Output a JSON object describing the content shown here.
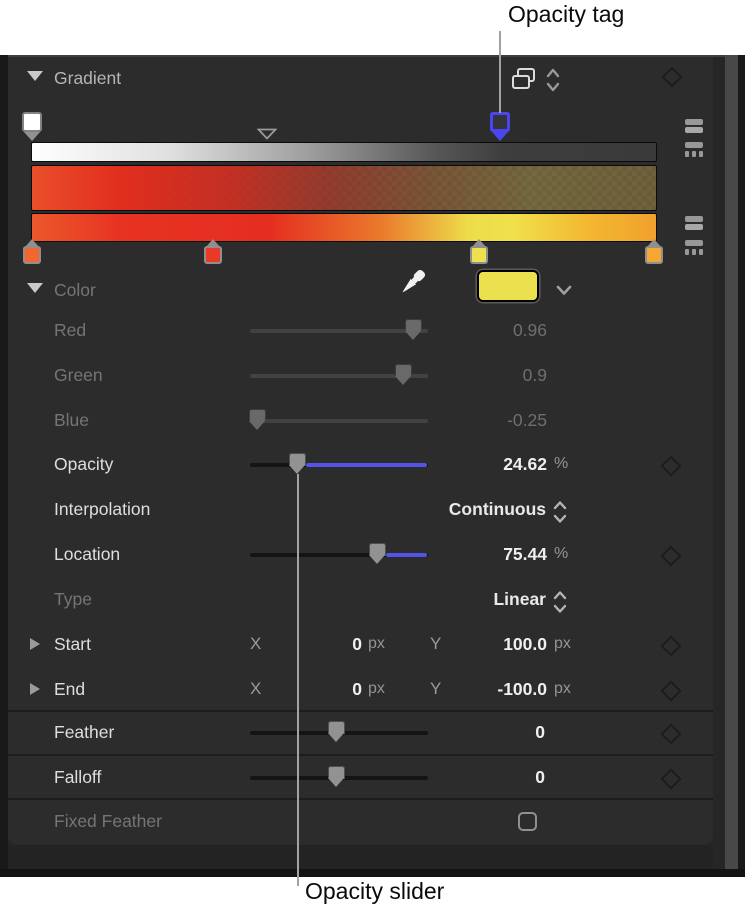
{
  "callouts": {
    "top_label": "Opacity tag",
    "bottom_label": "Opacity slider"
  },
  "gradient_section": {
    "title": "Gradient",
    "opacity_bar": {
      "left_stop_color": "#ffffff",
      "right_stop_color": "#3a3a3a",
      "selected_tag_location_pct": 75,
      "midpoint_pct": 38
    },
    "color_bar_stops": [
      "#ec582c",
      "#e63322",
      "#eedd4a",
      "#f1a02e"
    ],
    "color_tags": [
      {
        "color": "#f2672f",
        "position_pct": 0
      },
      {
        "color": "#e93a28",
        "position_pct": 29
      },
      {
        "color": "#eee04e",
        "position_pct": 72
      },
      {
        "color": "#f6a733",
        "position_pct": 100
      }
    ]
  },
  "color_section": {
    "title": "Color",
    "swatch_color": "#ebe14f",
    "red": {
      "label": "Red",
      "value": "0.96"
    },
    "green": {
      "label": "Green",
      "value": "0.9"
    },
    "blue": {
      "label": "Blue",
      "value": "-0.25"
    }
  },
  "params": {
    "opacity": {
      "label": "Opacity",
      "value": "24.62",
      "unit": "%"
    },
    "interpolation": {
      "label": "Interpolation",
      "value": "Continuous"
    },
    "location": {
      "label": "Location",
      "value": "75.44",
      "unit": "%"
    },
    "type": {
      "label": "Type",
      "value": "Linear"
    },
    "start": {
      "label": "Start",
      "x_label": "X",
      "x_value": "0",
      "x_unit": "px",
      "y_label": "Y",
      "y_value": "100.0",
      "y_unit": "px"
    },
    "end": {
      "label": "End",
      "x_label": "X",
      "x_value": "0",
      "x_unit": "px",
      "y_label": "Y",
      "y_value": "-100.0",
      "y_unit": "px"
    },
    "feather": {
      "label": "Feather",
      "value": "0"
    },
    "falloff": {
      "label": "Falloff",
      "value": "0"
    },
    "fixed_feather": {
      "label": "Fixed Feather",
      "checked": false
    }
  },
  "colors": {
    "accent_blue": "#5453e8",
    "selected_tag_border": "#4946ef",
    "panel_background": "#2c2c2c",
    "swatch_yellow": "#ebe14f",
    "callout_line": "#a2a2a2"
  },
  "icons": {
    "header": [
      "preset-stack-icon",
      "stepper-icon",
      "keyframe-diamond-icon"
    ],
    "color_row": [
      "eyedropper-icon",
      "chevron-down-icon"
    ],
    "gradient_right": [
      "gradient-bars-icon",
      "gradient-tags-icon"
    ],
    "rows": "keyframe-diamond-icon"
  }
}
